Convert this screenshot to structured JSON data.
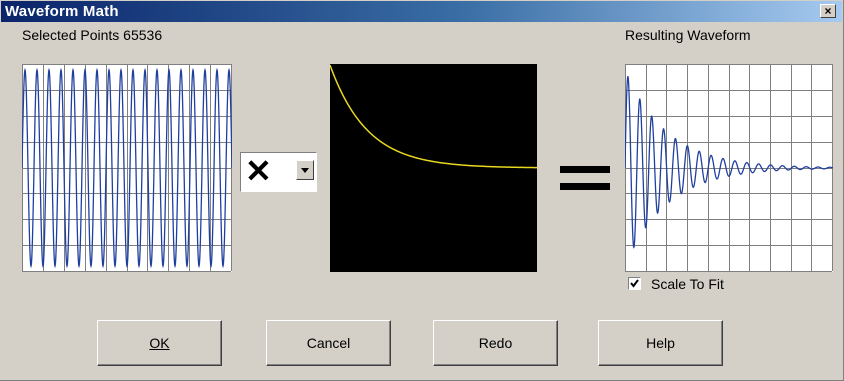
{
  "window": {
    "title": "Waveform Math",
    "close_glyph": "×"
  },
  "left_panel": {
    "label": "Selected Points 65536",
    "trace_color": "#2040a0"
  },
  "operator": {
    "selected": "✕"
  },
  "middle_panel": {
    "trace_color": "#e8d820",
    "background": "#000000"
  },
  "right_panel": {
    "label": "Resulting Waveform",
    "trace_color": "#2040a0"
  },
  "scale_to_fit": {
    "label": "Scale To Fit",
    "checked": true
  },
  "buttons": {
    "ok": "OK",
    "cancel": "Cancel",
    "redo": "Redo",
    "help": "Help"
  }
}
